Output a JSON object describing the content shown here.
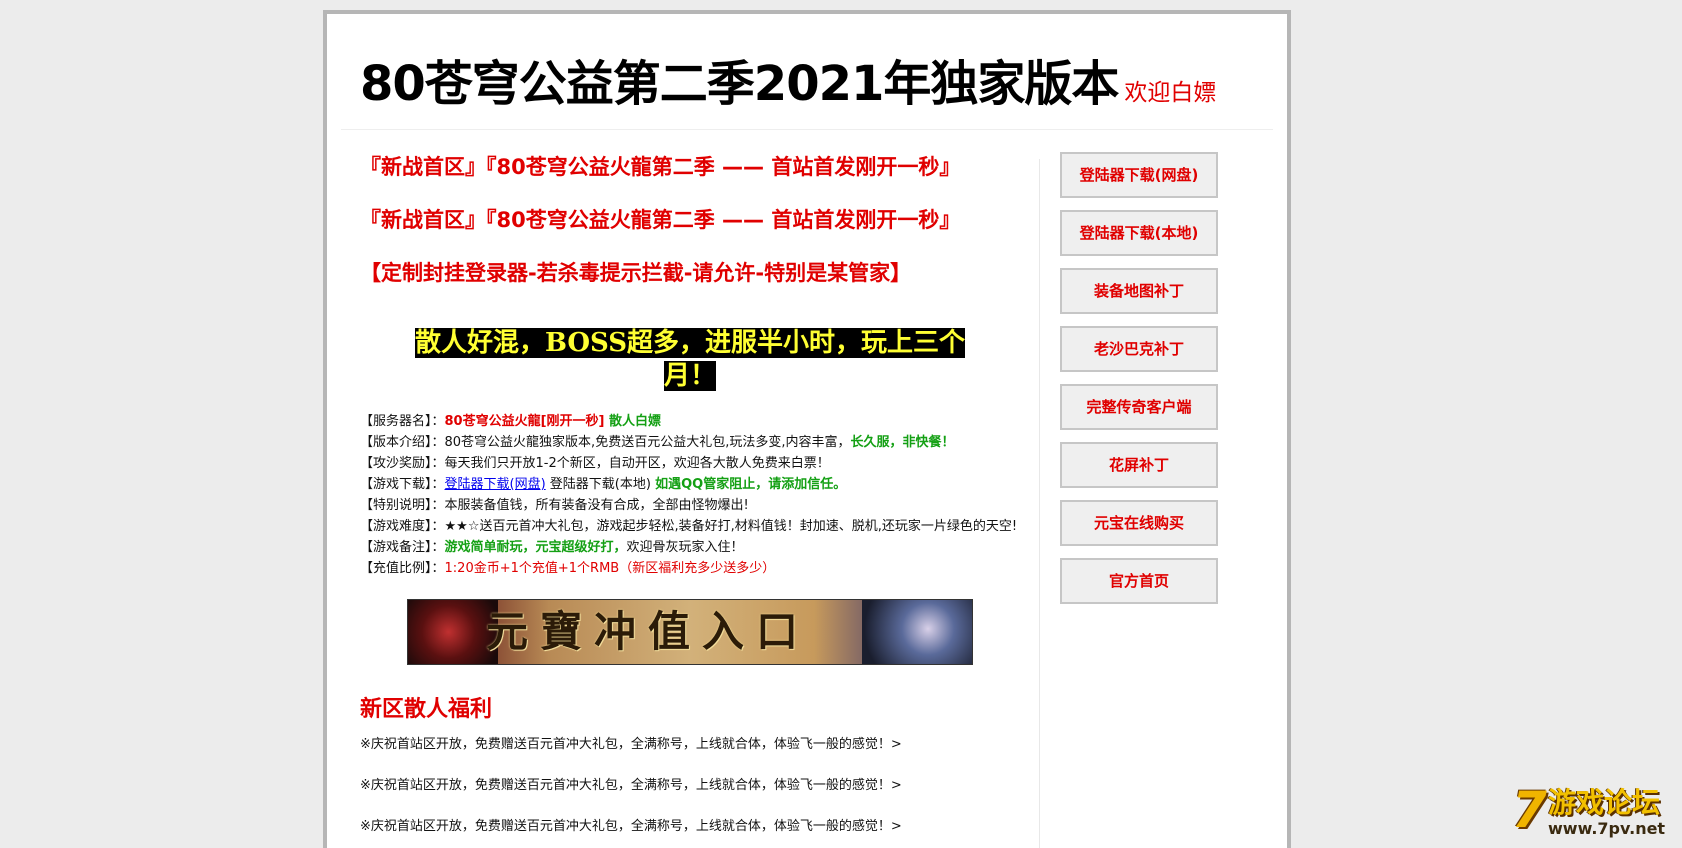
{
  "header": {
    "title": "80苍穹公益第二季2021年独家版本",
    "subtitle": "欢迎白嫖"
  },
  "headlines": [
    "『新战首区』『80苍穹公益火龍第二季 —— 首站首发刚开一秒』",
    "『新战首区』『80苍穹公益火龍第二季 —— 首站首发刚开一秒』",
    "【定制封挂登录器-若杀毒提示拦截-请允许-特别是某管家】"
  ],
  "slogan": {
    "line1": "散人好混，BOSS超多，进服半小时，玩上三个",
    "line2": "月！"
  },
  "info": {
    "server_name_label": "【服务器名】：",
    "server_name_value": "80苍穹公益火龍[刚开一秒]",
    "server_name_extra": " 散人白嫖",
    "intro_label": "【版本介绍】：",
    "intro_text": "80苍穹公益火龍独家版本,免费送百元公益大礼包,玩法多变,内容丰富，",
    "intro_highlight": "长久服，非快餐！",
    "siege_label": "【攻沙奖励】：",
    "siege_text": "每天我们只开放1-2个新区，自动开区，欢迎各大散人免费来白票！",
    "download_label": "【游戏下载】：",
    "download_link": "登陆器下载(网盘)",
    "download_local": " 登陆器下载(本地) ",
    "download_note": "如遇QQ管家阻止，请添加信任。",
    "special_label": "【特别说明】：",
    "special_text": "本服装备值钱，所有装备没有合成，全部由怪物爆出!",
    "difficulty_label": "【游戏难度】：",
    "difficulty_text": "★★☆送百元首冲大礼包，游戏起步轻松,装备好打,材料值钱！封加速、脱机,还玩家一片绿色的天空!",
    "remark_label": "【游戏备注】：",
    "remark_highlight": "游戏简单耐玩，元宝超级好打，",
    "remark_text": "欢迎骨灰玩家入住！",
    "ratio_label": "【充值比例】：",
    "ratio_value": "1:20金币+1个充值+1个RMB（新区福利充多少送多少）"
  },
  "banner": {
    "text": "元寶冲值入口"
  },
  "welfare": {
    "title": "新区散人福利",
    "items": [
      "※庆祝首站区开放，免费赠送百元首冲大礼包，全满称号，上线就合体，体验飞一般的感觉！>",
      "※庆祝首站区开放，免费赠送百元首冲大礼包，全满称号，上线就合体，体验飞一般的感觉！>",
      "※庆祝首站区开放，免费赠送百元首冲大礼包，全满称号，上线就合体，体验飞一般的感觉！>"
    ]
  },
  "sidebar": {
    "buttons": [
      "登陆器下载(网盘)",
      "登陆器下载(本地)",
      "装备地图补丁",
      "老沙巴克补丁",
      "完整传奇客户端",
      "花屏补丁",
      "元宝在线购买",
      "官方首页"
    ]
  },
  "watermark": {
    "digit": "7",
    "title": "游戏论坛",
    "url": "www.7pv.net"
  }
}
